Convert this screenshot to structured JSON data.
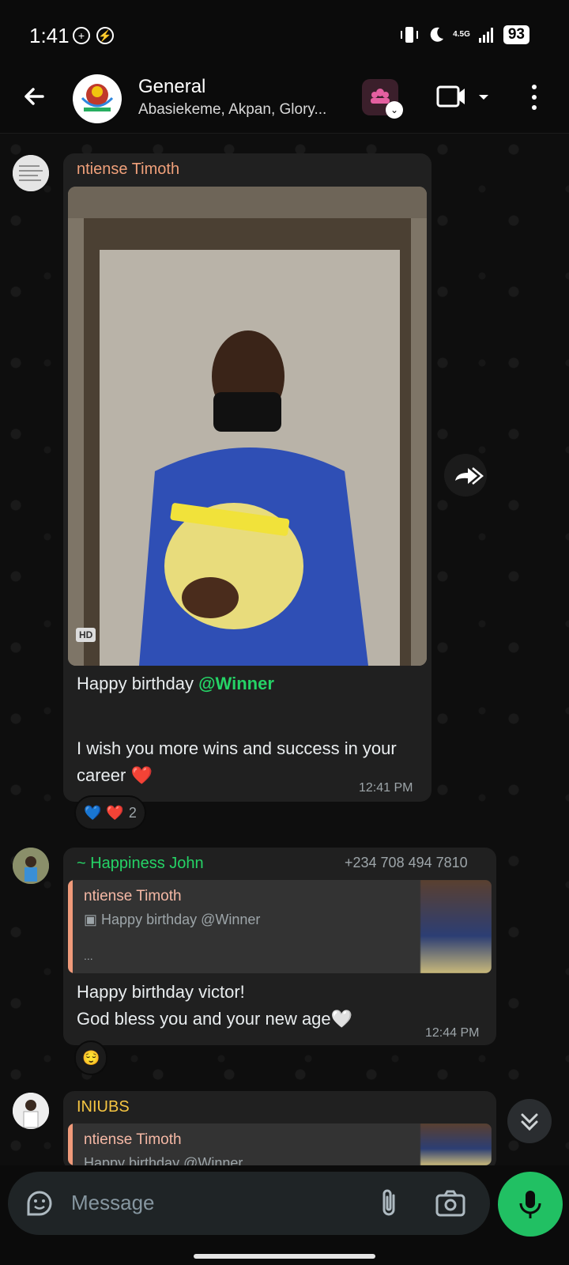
{
  "status": {
    "time": "1:41",
    "battery": "93",
    "network": "4.5G"
  },
  "header": {
    "title": "General",
    "subtitle": "Abasiekeme, Akpan, Glory..."
  },
  "messages": [
    {
      "sender": "ntiense Timoth",
      "sender_color": "#f0a07a",
      "hd_label": "HD",
      "text_line1_prefix": "Happy birthday ",
      "mention": "@Winner",
      "text_line2": "I wish you more wins and success in your",
      "text_line3": "career ❤️",
      "time": "12:41 PM",
      "reaction_count": "2"
    },
    {
      "sender": "~ Happiness John",
      "sender_color": "#25d366",
      "phone": "+234 708 494 7810",
      "quote_name": "ntiense Timoth",
      "quote_text": "Happy birthday @Winner",
      "quote_more": "...",
      "text_line1": "Happy birthday victor!",
      "text_line2": "God bless you and your new age🤍",
      "time": "12:44 PM",
      "reaction": "😌"
    },
    {
      "sender": "INIUBS",
      "sender_color": "#f5c542",
      "quote_name": "ntiense Timoth",
      "quote_text": "Happy birthday @Winner"
    }
  ],
  "composer": {
    "placeholder": "Message"
  }
}
